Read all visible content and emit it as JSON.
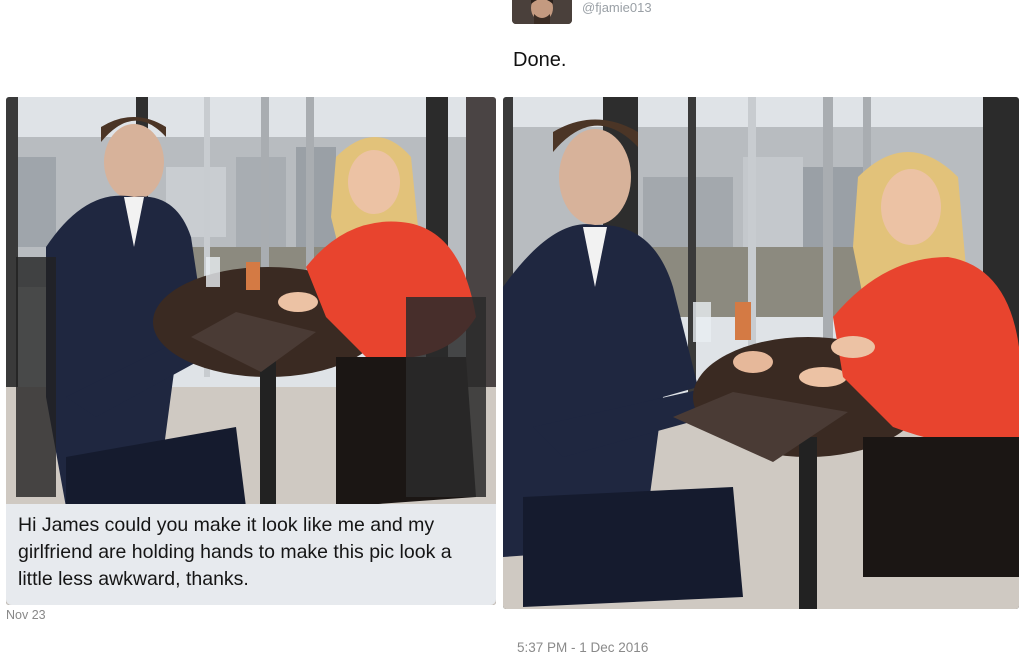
{
  "reply": {
    "handle": "@fjamie013",
    "text": "Done.",
    "timestamp": "5:37 PM - 1 Dec 2016"
  },
  "message": {
    "text": "Hi James could you make it look like me and my girlfriend are holding hands to make this pic look a little less awkward, thanks.",
    "date": "Nov 23"
  },
  "photos": {
    "left": {
      "label": "original-photo"
    },
    "right": {
      "label": "edited-photo"
    }
  },
  "colors": {
    "bubble": "#e7eaee",
    "meta_text": "#8a8a8a",
    "jacket": "#1f2740",
    "blouse": "#e8442e"
  }
}
